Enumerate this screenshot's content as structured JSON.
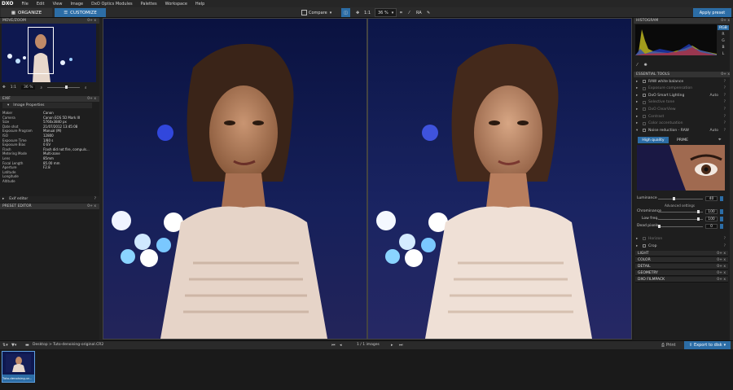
{
  "app": {
    "logo": "DXO"
  },
  "menu": [
    "File",
    "Edit",
    "View",
    "Image",
    "DxO Optics Modules",
    "Palettes",
    "Workspace",
    "Help"
  ],
  "toolbar": {
    "organize": "ORGANIZE",
    "customize": "CUSTOMIZE",
    "compare": "Compare",
    "zoom_11": "1:1",
    "zoom_pct": "36 %",
    "ra": "RA",
    "apply_preset": "Apply preset"
  },
  "left": {
    "move_zoom": "MOVE/ZOOM",
    "nav_zoom": "1:1",
    "nav_pct": "36 %",
    "exif_title": "EXIF",
    "image_properties": "Image Properties",
    "exif": [
      {
        "k": "Maker",
        "v": "Canon"
      },
      {
        "k": "Camera",
        "v": "Canon EOS 5D Mark III"
      },
      {
        "k": "Size",
        "v": "5760x3840 px"
      },
      {
        "k": "Date shot",
        "v": "21/07/2012 13:45:08"
      },
      {
        "k": "Exposure Program",
        "v": "Manual (M)"
      },
      {
        "k": "ISO",
        "v": "12800"
      },
      {
        "k": "Exposure Time",
        "v": "1/80 s"
      },
      {
        "k": "Exposure Bias",
        "v": "0 EV"
      },
      {
        "k": "Flash",
        "v": "Flash did not fire, compuls..."
      },
      {
        "k": "Metering Mode",
        "v": "Multi-zone"
      },
      {
        "k": "Lens",
        "v": "85mm"
      },
      {
        "k": "Focal Length",
        "v": "85.00 mm"
      },
      {
        "k": "Aperture",
        "v": "F2.8"
      },
      {
        "k": "Latitude",
        "v": ""
      },
      {
        "k": "Longitude",
        "v": ""
      },
      {
        "k": "Altitude",
        "v": ""
      }
    ],
    "exif_editor": "Exif editor",
    "preset_editor": "PRESET EDITOR"
  },
  "right": {
    "histogram": "HISTOGRAM",
    "channels": [
      "RGB",
      "R",
      "G",
      "B",
      "L"
    ],
    "essential_tools": "ESSENTIAL TOOLS",
    "tools": [
      {
        "label": "RAW white balance",
        "auto": "",
        "dim": false,
        "check": true
      },
      {
        "label": "Exposure compensation",
        "auto": "",
        "dim": true,
        "check": false
      },
      {
        "label": "DxO Smart Lighting",
        "auto": "Auto",
        "dim": false,
        "check": true
      },
      {
        "label": "Selective tone",
        "auto": "",
        "dim": true,
        "check": false
      },
      {
        "label": "DxO ClearView",
        "auto": "",
        "dim": true,
        "check": false
      },
      {
        "label": "Contrast",
        "auto": "",
        "dim": true,
        "check": false
      },
      {
        "label": "Color accentuation",
        "auto": "",
        "dim": true,
        "check": false
      },
      {
        "label": "Noise reduction - RAW",
        "auto": "Auto",
        "dim": false,
        "check": true
      }
    ],
    "hq": "High quality",
    "prime": "PRIME",
    "luminance": "Luminance",
    "luminance_val": "40",
    "advanced": "Advanced settings",
    "chrominance": "Chrominance",
    "chrominance_val": "100",
    "low_freq": "Low freq.",
    "low_freq_val": "100",
    "dead_pixels": "Dead pixels",
    "dead_pixels_val": "0",
    "horizon": "Horizon",
    "crop": "Crop",
    "palettes": [
      "LIGHT",
      "COLOR",
      "DETAIL",
      "GEOMETRY",
      "DXO FILMPACK"
    ],
    "palette_ctl": "0+ x"
  },
  "bottom": {
    "path": "Desktop > Tuto-denoising-original.CR2",
    "images": "1 / 1 images",
    "print": "Print",
    "export": "Export to disk"
  },
  "film": {
    "thumb_label": "Tuto-denoising-or..."
  },
  "colors": {
    "accent": "#2c6da6",
    "panel": "#1e1e1e"
  }
}
